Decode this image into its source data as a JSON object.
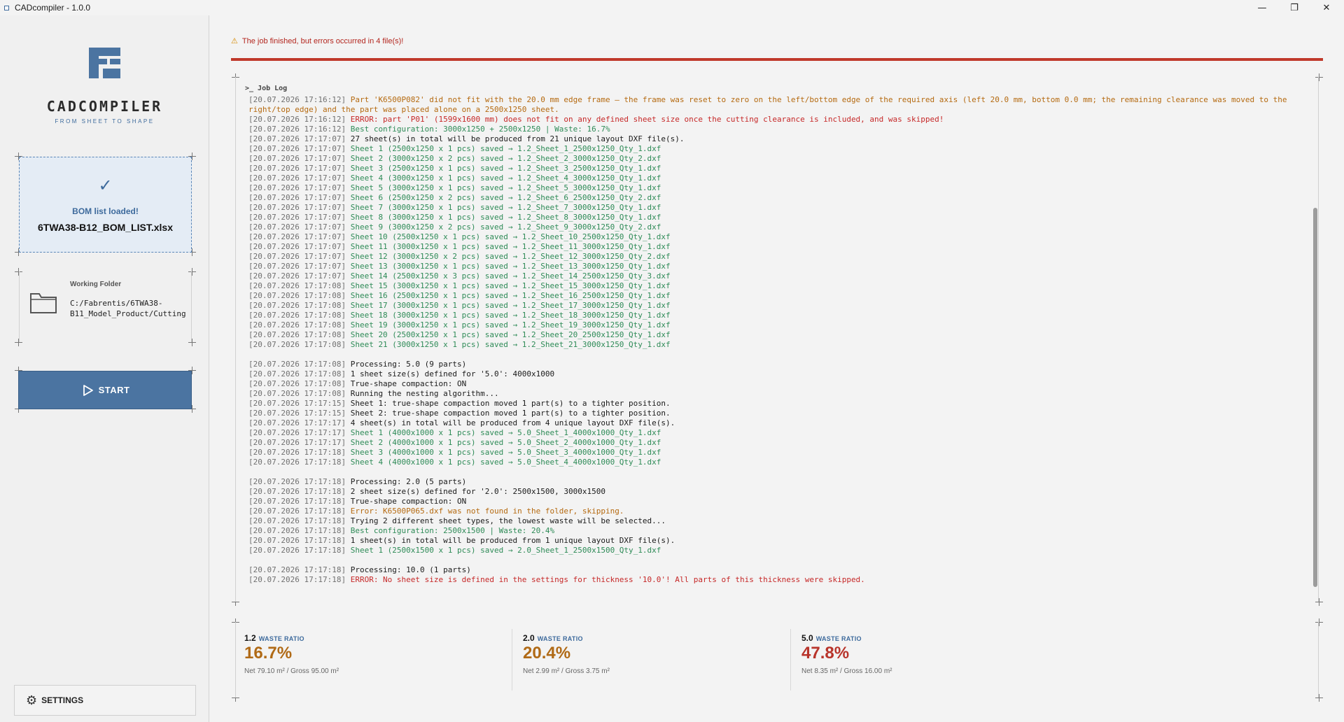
{
  "window": {
    "title": "CADcompiler - 1.0.0",
    "minimize_glyph": "—",
    "maximize_glyph": "❐",
    "close_glyph": "✕"
  },
  "sidebar": {
    "brand_name": "CADCOMPILER",
    "tagline": "FROM SHEET TO SHAPE",
    "bom": {
      "status": "BOM list loaded!",
      "file": "6TWA38-B12_BOM_LIST.xlsx",
      "icon": "check-icon"
    },
    "folder": {
      "label": "Working Folder",
      "path": "C:/Fabrentis/6TWA38-B11_Model_Product/Cutting",
      "icon": "folder-icon"
    },
    "start_label": "START",
    "settings_label": "SETTINGS"
  },
  "main": {
    "alert": "The job finished, but errors occurred in 4 file(s)!",
    "log_title": ">_ Job Log",
    "log": [
      {
        "ts": "[20.07.2026 17:16:12]",
        "msg": "Part 'K6500P082' did not fit with the 20.0 mm edge frame — the frame was reset to zero on the left/bottom edge of the required axis (left 20.0 mm, bottom 0.0 mm; the remaining clearance was moved to the right/top edge) and the part was placed alone on a 2500x1250 sheet.",
        "level": "warn"
      },
      {
        "ts": "[20.07.2026 17:16:12]",
        "msg": "ERROR: part 'P01' (1599x1600 mm) does not fit on any defined sheet size once the cutting clearance is included, and was skipped!",
        "level": "err"
      },
      {
        "ts": "[20.07.2026 17:16:12]",
        "msg": "Best configuration: 3000x1250 + 2500x1250 | Waste: 16.7%",
        "level": "ok"
      },
      {
        "ts": "[20.07.2026 17:17:07]",
        "msg": "27 sheet(s) in total will be produced from 21 unique layout DXF file(s).",
        "level": "info"
      },
      {
        "ts": "[20.07.2026 17:17:07]",
        "msg": "Sheet 1 (2500x1250 x 1 pcs) saved → 1.2_Sheet_1_2500x1250_Qty_1.dxf",
        "level": "ok"
      },
      {
        "ts": "[20.07.2026 17:17:07]",
        "msg": "Sheet 2 (3000x1250 x 2 pcs) saved → 1.2_Sheet_2_3000x1250_Qty_2.dxf",
        "level": "ok"
      },
      {
        "ts": "[20.07.2026 17:17:07]",
        "msg": "Sheet 3 (2500x1250 x 1 pcs) saved → 1.2_Sheet_3_2500x1250_Qty_1.dxf",
        "level": "ok"
      },
      {
        "ts": "[20.07.2026 17:17:07]",
        "msg": "Sheet 4 (3000x1250 x 1 pcs) saved → 1.2_Sheet_4_3000x1250_Qty_1.dxf",
        "level": "ok"
      },
      {
        "ts": "[20.07.2026 17:17:07]",
        "msg": "Sheet 5 (3000x1250 x 1 pcs) saved → 1.2_Sheet_5_3000x1250_Qty_1.dxf",
        "level": "ok"
      },
      {
        "ts": "[20.07.2026 17:17:07]",
        "msg": "Sheet 6 (2500x1250 x 2 pcs) saved → 1.2_Sheet_6_2500x1250_Qty_2.dxf",
        "level": "ok"
      },
      {
        "ts": "[20.07.2026 17:17:07]",
        "msg": "Sheet 7 (3000x1250 x 1 pcs) saved → 1.2_Sheet_7_3000x1250_Qty_1.dxf",
        "level": "ok"
      },
      {
        "ts": "[20.07.2026 17:17:07]",
        "msg": "Sheet 8 (3000x1250 x 1 pcs) saved → 1.2_Sheet_8_3000x1250_Qty_1.dxf",
        "level": "ok"
      },
      {
        "ts": "[20.07.2026 17:17:07]",
        "msg": "Sheet 9 (3000x1250 x 2 pcs) saved → 1.2_Sheet_9_3000x1250_Qty_2.dxf",
        "level": "ok"
      },
      {
        "ts": "[20.07.2026 17:17:07]",
        "msg": "Sheet 10 (2500x1250 x 1 pcs) saved → 1.2_Sheet_10_2500x1250_Qty_1.dxf",
        "level": "ok"
      },
      {
        "ts": "[20.07.2026 17:17:07]",
        "msg": "Sheet 11 (3000x1250 x 1 pcs) saved → 1.2_Sheet_11_3000x1250_Qty_1.dxf",
        "level": "ok"
      },
      {
        "ts": "[20.07.2026 17:17:07]",
        "msg": "Sheet 12 (3000x1250 x 2 pcs) saved → 1.2_Sheet_12_3000x1250_Qty_2.dxf",
        "level": "ok"
      },
      {
        "ts": "[20.07.2026 17:17:07]",
        "msg": "Sheet 13 (3000x1250 x 1 pcs) saved → 1.2_Sheet_13_3000x1250_Qty_1.dxf",
        "level": "ok"
      },
      {
        "ts": "[20.07.2026 17:17:07]",
        "msg": "Sheet 14 (2500x1250 x 3 pcs) saved → 1.2_Sheet_14_2500x1250_Qty_3.dxf",
        "level": "ok"
      },
      {
        "ts": "[20.07.2026 17:17:08]",
        "msg": "Sheet 15 (3000x1250 x 1 pcs) saved → 1.2_Sheet_15_3000x1250_Qty_1.dxf",
        "level": "ok"
      },
      {
        "ts": "[20.07.2026 17:17:08]",
        "msg": "Sheet 16 (2500x1250 x 1 pcs) saved → 1.2_Sheet_16_2500x1250_Qty_1.dxf",
        "level": "ok"
      },
      {
        "ts": "[20.07.2026 17:17:08]",
        "msg": "Sheet 17 (3000x1250 x 1 pcs) saved → 1.2_Sheet_17_3000x1250_Qty_1.dxf",
        "level": "ok"
      },
      {
        "ts": "[20.07.2026 17:17:08]",
        "msg": "Sheet 18 (3000x1250 x 1 pcs) saved → 1.2_Sheet_18_3000x1250_Qty_1.dxf",
        "level": "ok"
      },
      {
        "ts": "[20.07.2026 17:17:08]",
        "msg": "Sheet 19 (3000x1250 x 1 pcs) saved → 1.2_Sheet_19_3000x1250_Qty_1.dxf",
        "level": "ok"
      },
      {
        "ts": "[20.07.2026 17:17:08]",
        "msg": "Sheet 20 (2500x1250 x 1 pcs) saved → 1.2_Sheet_20_2500x1250_Qty_1.dxf",
        "level": "ok"
      },
      {
        "ts": "[20.07.2026 17:17:08]",
        "msg": "Sheet 21 (3000x1250 x 1 pcs) saved → 1.2_Sheet_21_3000x1250_Qty_1.dxf",
        "level": "ok"
      },
      {
        "ts": "",
        "msg": "",
        "level": "blank"
      },
      {
        "ts": "[20.07.2026 17:17:08]",
        "msg": "Processing: 5.0 (9 parts)",
        "level": "info"
      },
      {
        "ts": "[20.07.2026 17:17:08]",
        "msg": "1 sheet size(s) defined for '5.0': 4000x1000",
        "level": "info"
      },
      {
        "ts": "[20.07.2026 17:17:08]",
        "msg": "True-shape compaction: ON",
        "level": "info"
      },
      {
        "ts": "[20.07.2026 17:17:08]",
        "msg": "Running the nesting algorithm...",
        "level": "info"
      },
      {
        "ts": "[20.07.2026 17:17:15]",
        "msg": "Sheet 1: true-shape compaction moved 1 part(s) to a tighter position.",
        "level": "info"
      },
      {
        "ts": "[20.07.2026 17:17:15]",
        "msg": "Sheet 2: true-shape compaction moved 1 part(s) to a tighter position.",
        "level": "info"
      },
      {
        "ts": "[20.07.2026 17:17:17]",
        "msg": "4 sheet(s) in total will be produced from 4 unique layout DXF file(s).",
        "level": "info"
      },
      {
        "ts": "[20.07.2026 17:17:17]",
        "msg": "Sheet 1 (4000x1000 x 1 pcs) saved → 5.0_Sheet_1_4000x1000_Qty_1.dxf",
        "level": "ok"
      },
      {
        "ts": "[20.07.2026 17:17:17]",
        "msg": "Sheet 2 (4000x1000 x 1 pcs) saved → 5.0_Sheet_2_4000x1000_Qty_1.dxf",
        "level": "ok"
      },
      {
        "ts": "[20.07.2026 17:17:18]",
        "msg": "Sheet 3 (4000x1000 x 1 pcs) saved → 5.0_Sheet_3_4000x1000_Qty_1.dxf",
        "level": "ok"
      },
      {
        "ts": "[20.07.2026 17:17:18]",
        "msg": "Sheet 4 (4000x1000 x 1 pcs) saved → 5.0_Sheet_4_4000x1000_Qty_1.dxf",
        "level": "ok"
      },
      {
        "ts": "",
        "msg": "",
        "level": "blank"
      },
      {
        "ts": "[20.07.2026 17:17:18]",
        "msg": "Processing: 2.0 (5 parts)",
        "level": "info"
      },
      {
        "ts": "[20.07.2026 17:17:18]",
        "msg": "2 sheet size(s) defined for '2.0': 2500x1500, 3000x1500",
        "level": "info"
      },
      {
        "ts": "[20.07.2026 17:17:18]",
        "msg": "True-shape compaction: ON",
        "level": "info"
      },
      {
        "ts": "[20.07.2026 17:17:18]",
        "msg": "Error: K6500P065.dxf was not found in the folder, skipping.",
        "level": "warn"
      },
      {
        "ts": "[20.07.2026 17:17:18]",
        "msg": "Trying 2 different sheet types, the lowest waste will be selected...",
        "level": "info"
      },
      {
        "ts": "[20.07.2026 17:17:18]",
        "msg": "Best configuration: 2500x1500 | Waste: 20.4%",
        "level": "ok"
      },
      {
        "ts": "[20.07.2026 17:17:18]",
        "msg": "1 sheet(s) in total will be produced from 1 unique layout DXF file(s).",
        "level": "info"
      },
      {
        "ts": "[20.07.2026 17:17:18]",
        "msg": "Sheet 1 (2500x1500 x 1 pcs) saved → 2.0_Sheet_1_2500x1500_Qty_1.dxf",
        "level": "ok"
      },
      {
        "ts": "",
        "msg": "",
        "level": "blank"
      },
      {
        "ts": "[20.07.2026 17:17:18]",
        "msg": "Processing: 10.0 (1 parts)",
        "level": "info"
      },
      {
        "ts": "[20.07.2026 17:17:18]",
        "msg": "ERROR: No sheet size is defined in the settings for thickness '10.0'! All parts of this thickness were skipped.",
        "level": "err"
      }
    ],
    "stats": [
      {
        "thickness": "1.2",
        "label": "WASTE RATIO",
        "value": "16.7%",
        "detail": "Net 79.10 m² / Gross 95.00 m²",
        "color": "#b06a16"
      },
      {
        "thickness": "2.0",
        "label": "WASTE RATIO",
        "value": "20.4%",
        "detail": "Net 2.99 m² / Gross 3.75 m²",
        "color": "#b06a16"
      },
      {
        "thickness": "5.0",
        "label": "WASTE RATIO",
        "value": "47.8%",
        "detail": "Net 8.35 m² / Gross 16.00 m²",
        "color": "#b8342b"
      }
    ]
  },
  "colors": {
    "accent": "#4b74a1",
    "error": "#c62828",
    "warning": "#b56a10",
    "success": "#2e8b57"
  }
}
